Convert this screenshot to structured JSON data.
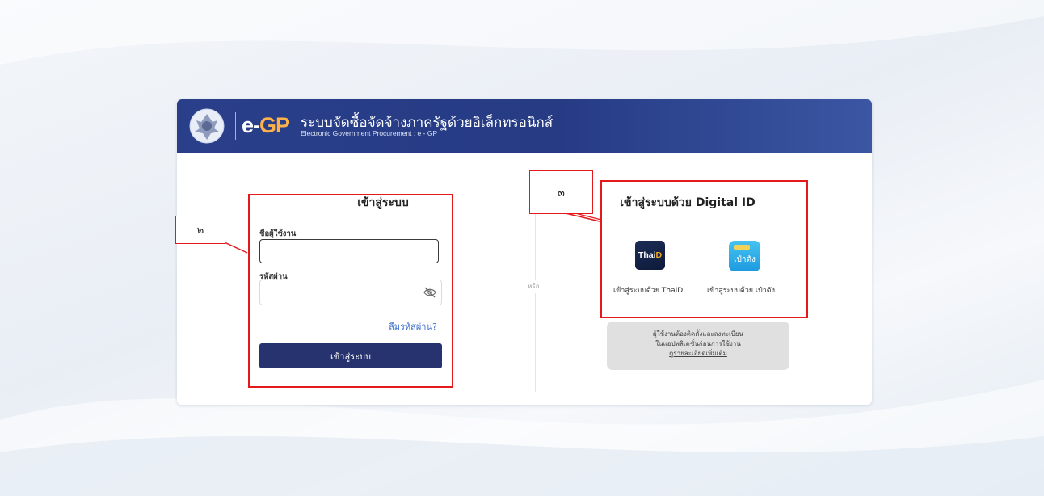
{
  "banner": {
    "logo_e": "e-",
    "logo_gp": "GP",
    "title": "ระบบจัดซื้อจัดจ้างภาครัฐด้วยอิเล็กทรอนิกส์",
    "subtitle": "Electronic Government Procurement : e - GP"
  },
  "login": {
    "title": "เข้าสู่ระบบ",
    "username_label": "ชื่อผู้ใช้งาน",
    "username_value": "",
    "password_label": "รหัสผ่าน",
    "password_value": "",
    "forgot_link": "ลืมรหัสผ่าน?",
    "submit_label": "เข้าสู่ระบบ"
  },
  "divider": {
    "or_text": "หรือ"
  },
  "digital_id": {
    "title": "เข้าสู่ระบบด้วย Digital ID",
    "thaid_icon_text": "Thai",
    "thaid_icon_accent": "D",
    "thaid_label": "เข้าสู่ระบบด้วย ThaID",
    "paotang_icon_text": "เป๋าตัง",
    "paotang_label": "เข้าสู่ระบบด้วย เป๋าตัง",
    "note_line1": "ผู้ใช้งานต้องติดตั้งและลงทะเบียน",
    "note_line2": "ในแอปพลิเคชั่นก่อนการใช้งาน",
    "note_link": "ดูรายละเอียดเพิ่มเติม"
  },
  "annotations": {
    "callout_2": "๒",
    "callout_3": "๓",
    "color": "#e3191c"
  },
  "colors": {
    "banner": "#263b84",
    "login_button": "#27336e",
    "link": "#3d6fc8"
  }
}
